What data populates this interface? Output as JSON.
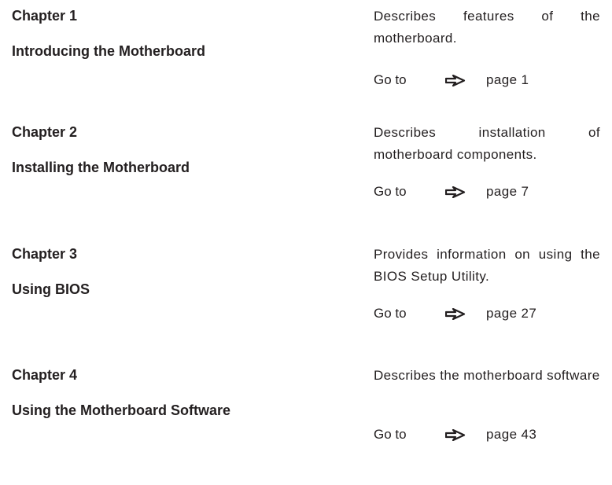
{
  "chapters": [
    {
      "number_label": "Chapter 1",
      "title": "Introducing the Motherboard",
      "description": "Describes features of the motherboard.",
      "goto_label": "Go to",
      "goto_icon": "right-arrow-icon",
      "page_ref": "page 1"
    },
    {
      "number_label": "Chapter 2",
      "title": "Installing the Motherboard",
      "description": "Describes installation of motherboard components.",
      "goto_label": "Go to",
      "goto_icon": "right-arrow-icon",
      "page_ref": "page 7"
    },
    {
      "number_label": "Chapter 3",
      "title": "Using BIOS",
      "description": "Provides information on using the BIOS Setup Utility.",
      "goto_label": "Go to",
      "goto_icon": "right-arrow-icon",
      "page_ref": "page 27"
    },
    {
      "number_label": "Chapter 4",
      "title": "Using the Motherboard Software",
      "description": "Describes the motherboard software",
      "goto_label": "Go to",
      "goto_icon": "right-arrow-icon",
      "page_ref": "page 43"
    }
  ],
  "colors": {
    "text": "#231f20",
    "background": "#ffffff"
  }
}
